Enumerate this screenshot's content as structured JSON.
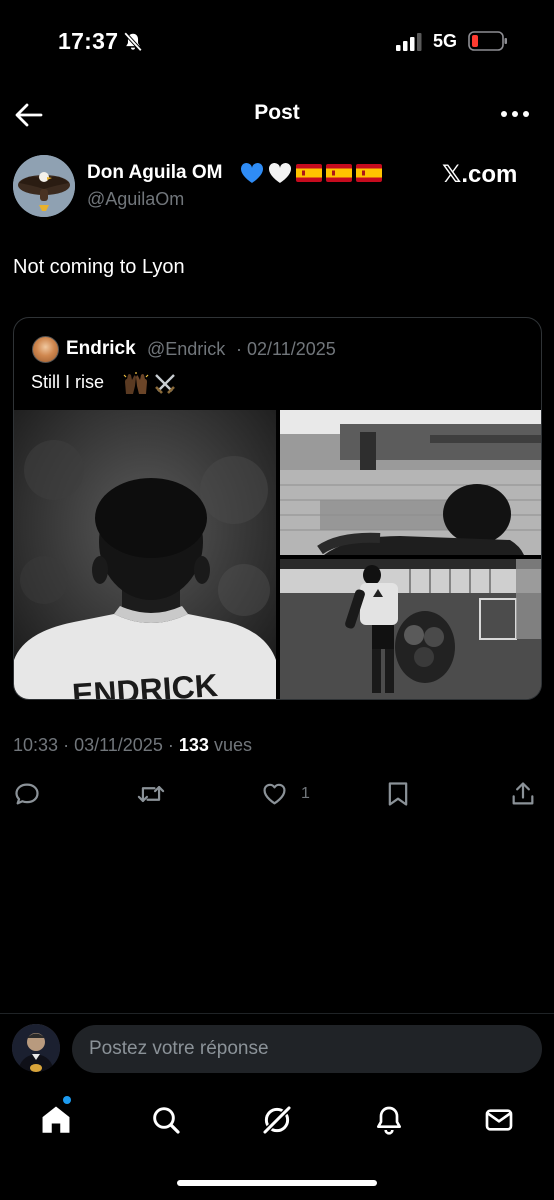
{
  "status_bar": {
    "time": "17:37",
    "network": "5G",
    "icons": [
      "bell-slash-icon",
      "signal-bars-icon",
      "battery-low-icon"
    ],
    "battery_color": "#ff3b30"
  },
  "header": {
    "title": "Post",
    "back_icon": "arrow-left-icon",
    "more_icon": "more-horizontal-icon"
  },
  "post": {
    "author": {
      "name": "Don Aguila OM",
      "name_emojis": [
        "blue-heart",
        "white-heart",
        "spain-flag",
        "spain-flag",
        "spain-flag"
      ],
      "handle": "@AguilaOm"
    },
    "watermark": "𝕏.com",
    "text": "Not coming to Lyon",
    "quote": {
      "name": "Endrick",
      "handle": "@Endrick",
      "separator": "·",
      "date": "02/11/2025",
      "text": "Still I rise",
      "text_emojis": [
        "raising-hands-dark-skin",
        "crossed-swords"
      ],
      "media": [
        {
          "name": "player-back-jersey-photo",
          "jersey_text": "ENDRICK"
        },
        {
          "name": "player-poolside-photo"
        },
        {
          "name": "player-walking-training-photo"
        }
      ]
    },
    "meta": {
      "time": "10:33",
      "dot": "·",
      "date": "03/11/2025",
      "views_count": "133",
      "views_label": "vues"
    },
    "actions": {
      "reply_icon": "reply-bubble-icon",
      "repost_icon": "repost-icon",
      "like_icon": "heart-icon",
      "like_count": "1",
      "bookmark_icon": "bookmark-icon",
      "share_icon": "share-icon"
    }
  },
  "reply_bar": {
    "placeholder": "Postez votre réponse"
  },
  "tab_bar": {
    "items": [
      "home-icon",
      "search-icon",
      "grok-icon",
      "notifications-bell-icon",
      "messages-envelope-icon"
    ],
    "active": "home-icon",
    "accent": "#1d9bf0"
  },
  "colors": {
    "background": "#000000",
    "text": "#e7e9ea",
    "muted": "#71767b",
    "border": "#2f3336"
  }
}
